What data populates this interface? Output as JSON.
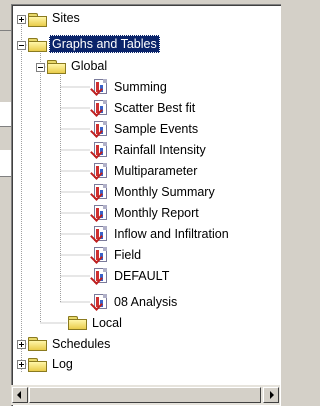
{
  "tree": {
    "sites": {
      "label": "Sites",
      "expanded": false
    },
    "graphs_tables": {
      "label": "Graphs and Tables",
      "expanded": true,
      "selected": true
    },
    "global": {
      "label": "Global",
      "expanded": true
    },
    "reports": [
      {
        "label": "Summing",
        "icon": "report-chart-icon"
      },
      {
        "label": "Scatter Best fit",
        "icon": "report-chart-icon"
      },
      {
        "label": "Sample Events",
        "icon": "report-chart-icon"
      },
      {
        "label": "Rainfall Intensity",
        "icon": "report-chart-icon"
      },
      {
        "label": "Multiparameter",
        "icon": "report-chart-icon"
      },
      {
        "label": "Monthly Summary",
        "icon": "report-chart-icon"
      },
      {
        "label": "Monthly Report",
        "icon": "report-chart-icon"
      },
      {
        "label": "Inflow and Infiltration",
        "icon": "report-chart-icon"
      },
      {
        "label": "Field",
        "icon": "report-chart-icon"
      },
      {
        "label": "DEFAULT",
        "icon": "report-chart-icon"
      },
      {
        "label": "08 Analysis",
        "icon": "report-chart-icon"
      }
    ],
    "local": {
      "label": "Local"
    },
    "schedules": {
      "label": "Schedules",
      "expanded": false
    },
    "log": {
      "label": "Log",
      "expanded": false
    }
  },
  "colors": {
    "selection": "#0a246a",
    "background": "#ffffff",
    "folder": "#f0d860"
  }
}
